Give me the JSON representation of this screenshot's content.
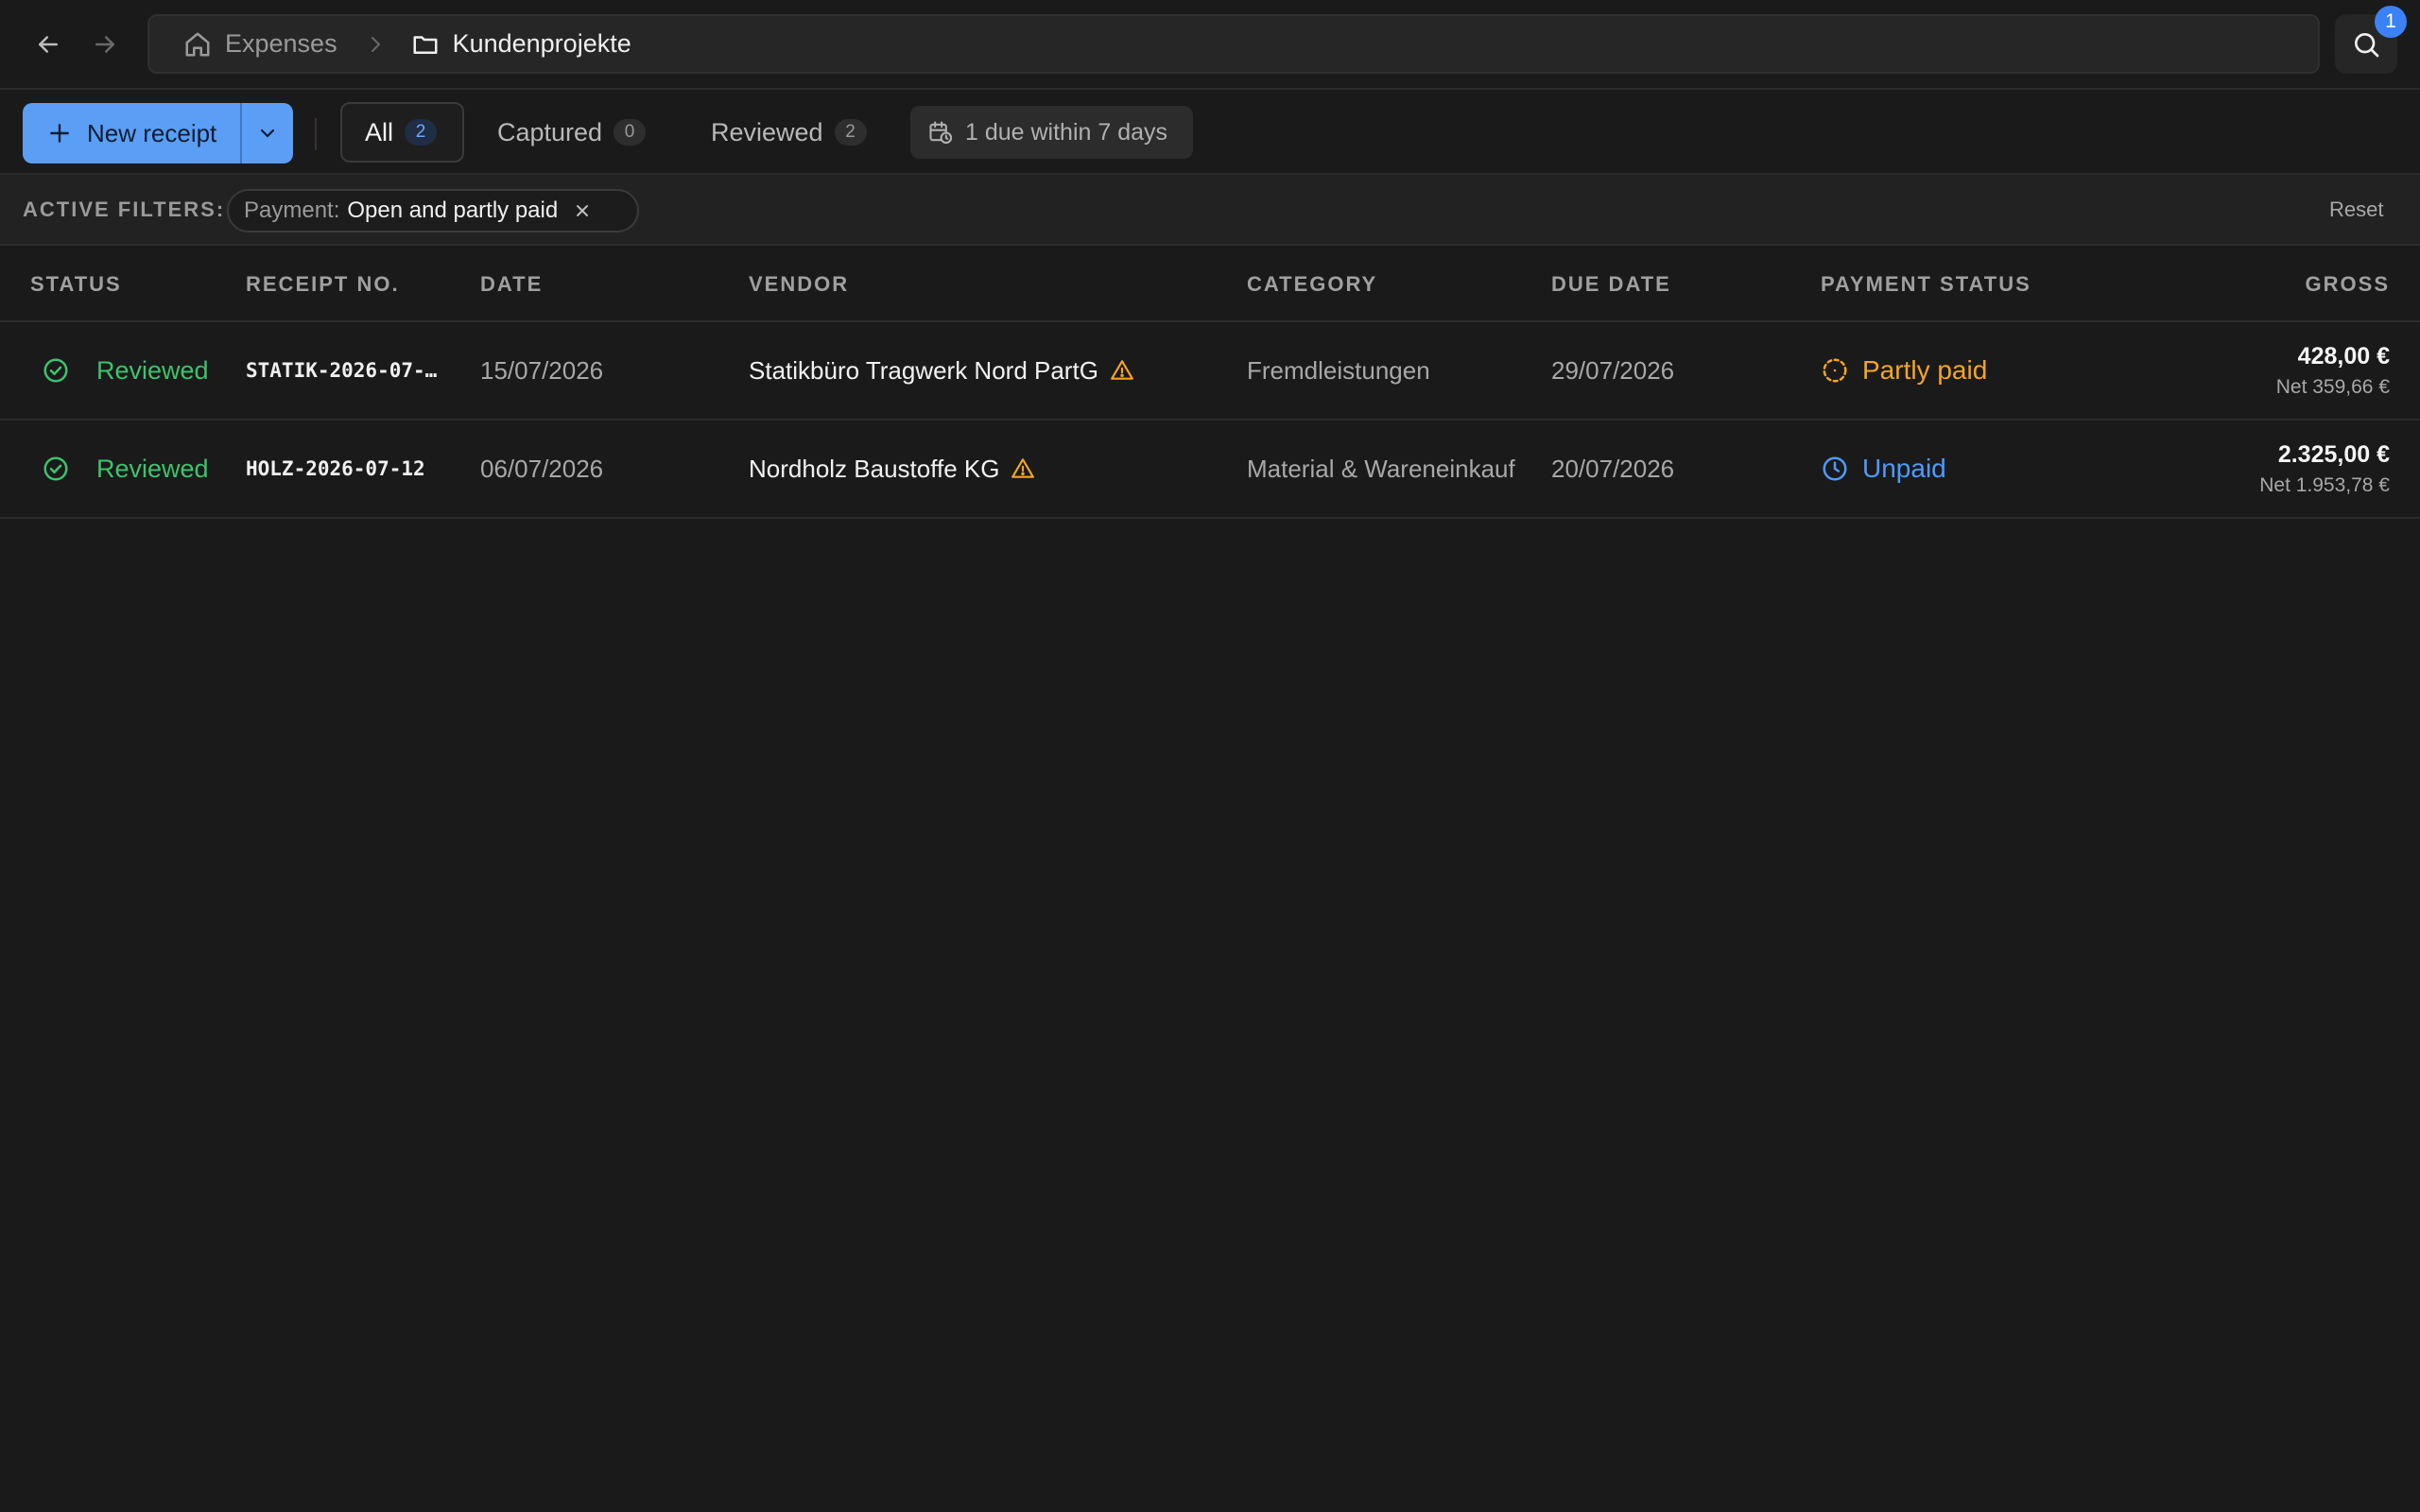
{
  "colors": {
    "background": "#1a1a1a",
    "accent": "#5a9ef5",
    "reviewed": "#3ec26d",
    "partly_paid": "#f5a524",
    "unpaid": "#4d9bff",
    "warning": "#f5a524"
  },
  "nav": {
    "back_icon": "arrow-left-icon",
    "forward_icon": "arrow-right-icon"
  },
  "breadcrumb": {
    "home": {
      "icon": "home-icon",
      "label": "Expenses"
    },
    "separator_icon": "chevron-right-icon",
    "current": {
      "icon": "folder-icon",
      "label": "Kundenprojekte"
    }
  },
  "search": {
    "icon": "search-icon",
    "badge": "1"
  },
  "toolbar": {
    "new_receipt_label": "New receipt",
    "new_receipt_icon": "plus-icon",
    "split_icon": "chevron-down-icon",
    "tabs": [
      {
        "label": "All",
        "count": "2",
        "active": true
      },
      {
        "label": "Captured",
        "count": "0",
        "active": false
      },
      {
        "label": "Reviewed",
        "count": "2",
        "active": false
      }
    ],
    "due_chip": {
      "icon": "calendar-clock-icon",
      "label": "1 due within 7 days"
    }
  },
  "filters": {
    "label": "ACTIVE FILTERS:",
    "chips": [
      {
        "key": "Payment:",
        "value": "Open and partly paid"
      }
    ],
    "reset_label": "Reset"
  },
  "table": {
    "columns": [
      "STATUS",
      "RECEIPT NO.",
      "DATE",
      "VENDOR",
      "CATEGORY",
      "DUE DATE",
      "PAYMENT STATUS",
      "GROSS"
    ],
    "rows": [
      {
        "status": "Reviewed",
        "receipt_no": "STATIK-2026-07-…",
        "date": "15/07/2026",
        "vendor": "Statikbüro Tragwerk Nord PartG",
        "category": "Fremdleistungen",
        "due_date": "29/07/2026",
        "payment_status": "Partly paid",
        "gross": "428,00 €",
        "net": "Net 359,66 €"
      },
      {
        "status": "Reviewed",
        "receipt_no": "HOLZ-2026-07-12",
        "date": "06/07/2026",
        "vendor": "Nordholz Baustoffe KG",
        "category": "Material & Wareneinkauf",
        "due_date": "20/07/2026",
        "payment_status": "Unpaid",
        "gross": "2.325,00 €",
        "net": "Net 1.953,78 €"
      }
    ]
  }
}
